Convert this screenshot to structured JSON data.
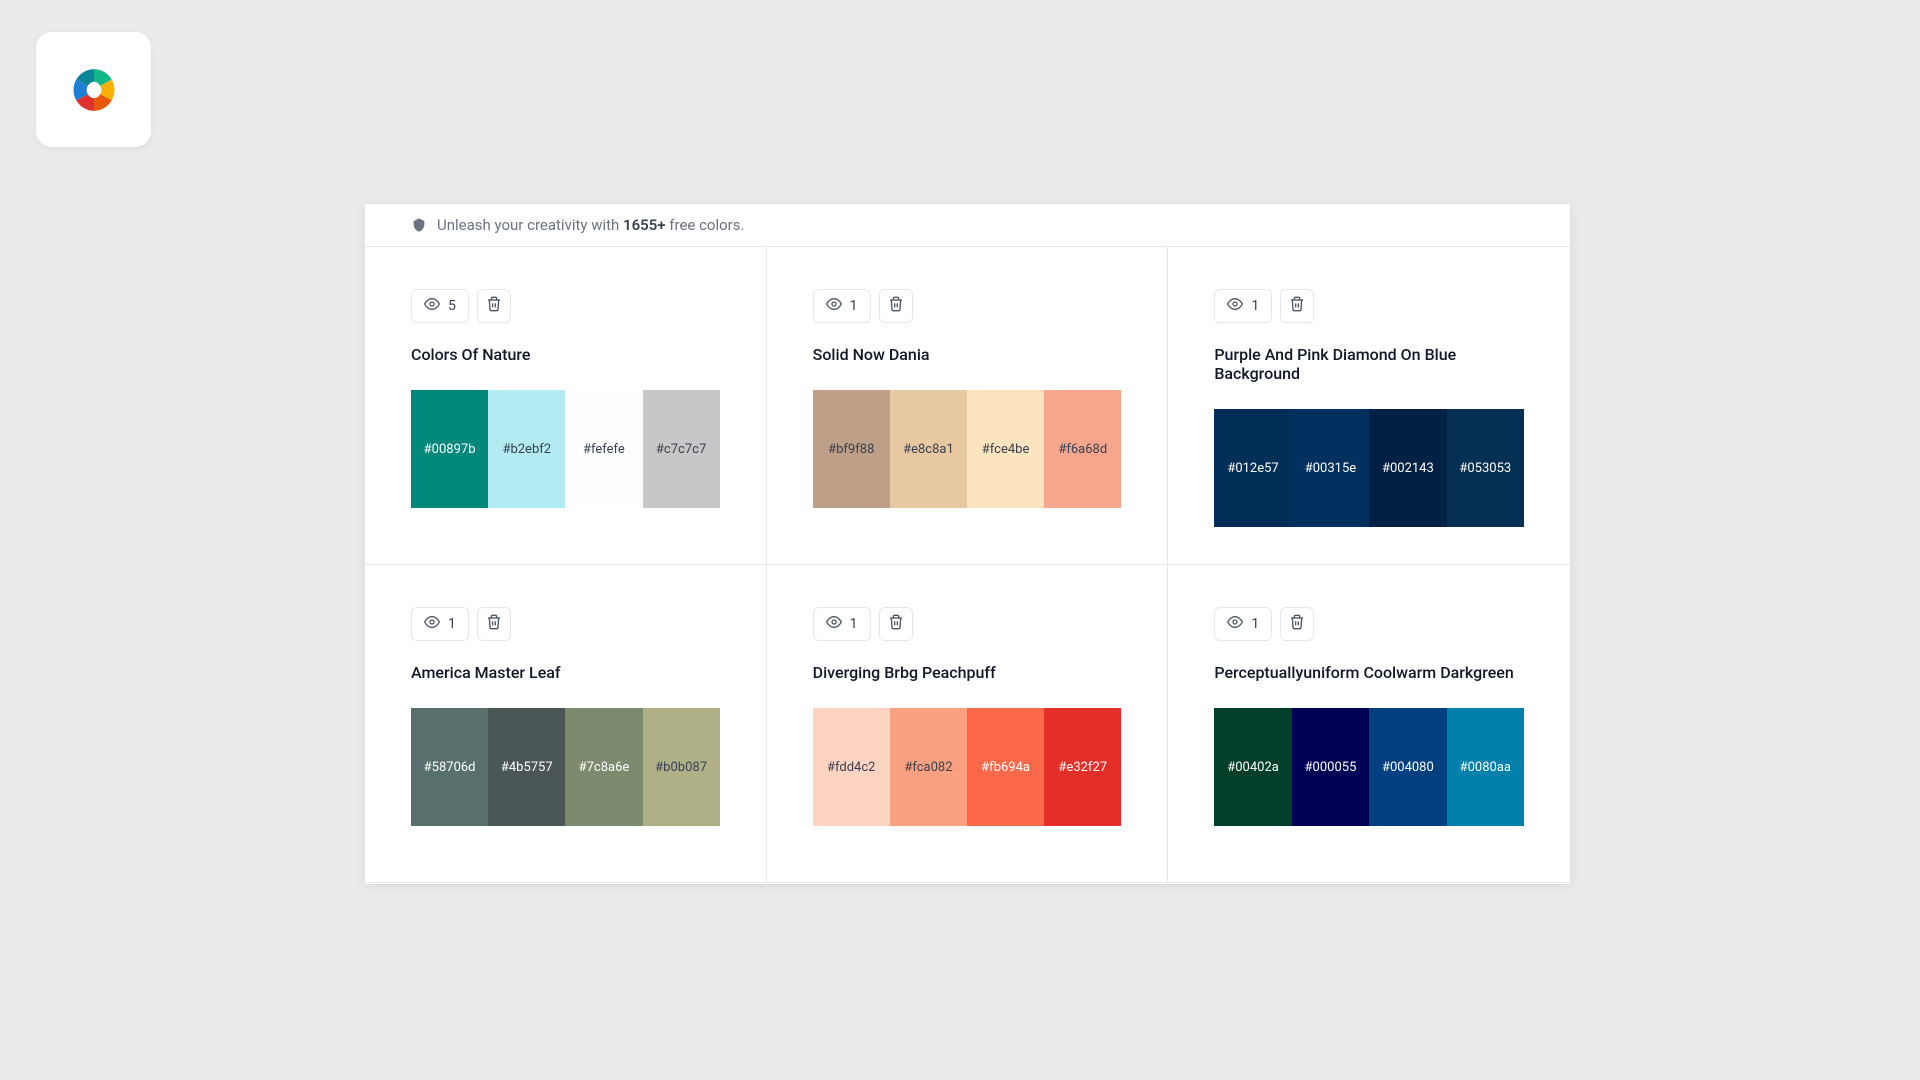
{
  "tagline": {
    "prefix": "Unleash your creativity with ",
    "count": "1655+",
    "suffix": " free colors."
  },
  "palettes": [
    {
      "views": "5",
      "title": "Colors Of Nature",
      "colors": [
        {
          "hex": "#00897b",
          "darkText": false
        },
        {
          "hex": "#b2ebf2",
          "darkText": true
        },
        {
          "hex": "#fefefe",
          "darkText": true
        },
        {
          "hex": "#c7c7c7",
          "darkText": true
        }
      ]
    },
    {
      "views": "1",
      "title": "Solid Now Dania",
      "colors": [
        {
          "hex": "#bf9f88",
          "darkText": true
        },
        {
          "hex": "#e8c8a1",
          "darkText": true
        },
        {
          "hex": "#fce4be",
          "darkText": true
        },
        {
          "hex": "#f6a68d",
          "darkText": true
        }
      ]
    },
    {
      "views": "1",
      "title": "Purple And Pink Diamond On Blue Background",
      "colors": [
        {
          "hex": "#012e57",
          "darkText": false
        },
        {
          "hex": "#00315e",
          "darkText": false
        },
        {
          "hex": "#002143",
          "darkText": false
        },
        {
          "hex": "#053053",
          "darkText": false
        }
      ]
    },
    {
      "views": "1",
      "title": "America Master Leaf",
      "colors": [
        {
          "hex": "#58706d",
          "darkText": false
        },
        {
          "hex": "#4b5757",
          "darkText": false
        },
        {
          "hex": "#7c8a6e",
          "darkText": false
        },
        {
          "hex": "#b0b087",
          "darkText": true
        }
      ]
    },
    {
      "views": "1",
      "title": "Diverging Brbg Peachpuff",
      "colors": [
        {
          "hex": "#fdd4c2",
          "darkText": true
        },
        {
          "hex": "#fca082",
          "darkText": true
        },
        {
          "hex": "#fb694a",
          "darkText": false
        },
        {
          "hex": "#e32f27",
          "darkText": false
        }
      ]
    },
    {
      "views": "1",
      "title": "Perceptuallyuniform Coolwarm Darkgreen",
      "colors": [
        {
          "hex": "#00402a",
          "darkText": false
        },
        {
          "hex": "#000055",
          "darkText": false
        },
        {
          "hex": "#004080",
          "darkText": false
        },
        {
          "hex": "#0080aa",
          "darkText": false
        }
      ]
    }
  ]
}
